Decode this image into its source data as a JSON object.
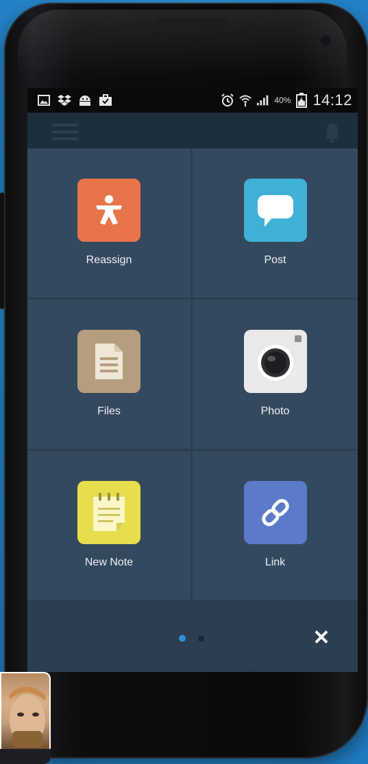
{
  "status_bar": {
    "battery_percent": "40%",
    "time": "14:12",
    "left_icons": [
      "gallery-icon",
      "dropbox-icon",
      "android-icon",
      "briefcase-icon"
    ],
    "right_icons": [
      "alarm-icon",
      "wifi-icon",
      "signal-icon",
      "battery-icon"
    ]
  },
  "app_bar": {
    "icons": [
      "menu-icon",
      "notification-bell-icon"
    ]
  },
  "actions": [
    {
      "label": "Reassign",
      "icon": "person-icon",
      "color": "#e8754a"
    },
    {
      "label": "Post",
      "icon": "speech-bubble-icon",
      "color": "#3fb1d6"
    },
    {
      "label": "Files",
      "icon": "document-icon",
      "color": "#b59e7e"
    },
    {
      "label": "Photo",
      "icon": "camera-icon",
      "color": "#e9e9e9"
    },
    {
      "label": "New Note",
      "icon": "notepad-icon",
      "color": "#e7de4e"
    },
    {
      "label": "Link",
      "icon": "link-icon",
      "color": "#5b7ac7"
    }
  ],
  "pager": {
    "pages": 2,
    "current": 1
  },
  "footer": {
    "close_symbol": "✕"
  },
  "colors": {
    "screen_bg": "#34495e",
    "divider": "#2c3e50",
    "pager_active": "#2d8fd9",
    "background": "#2a8fd2"
  }
}
